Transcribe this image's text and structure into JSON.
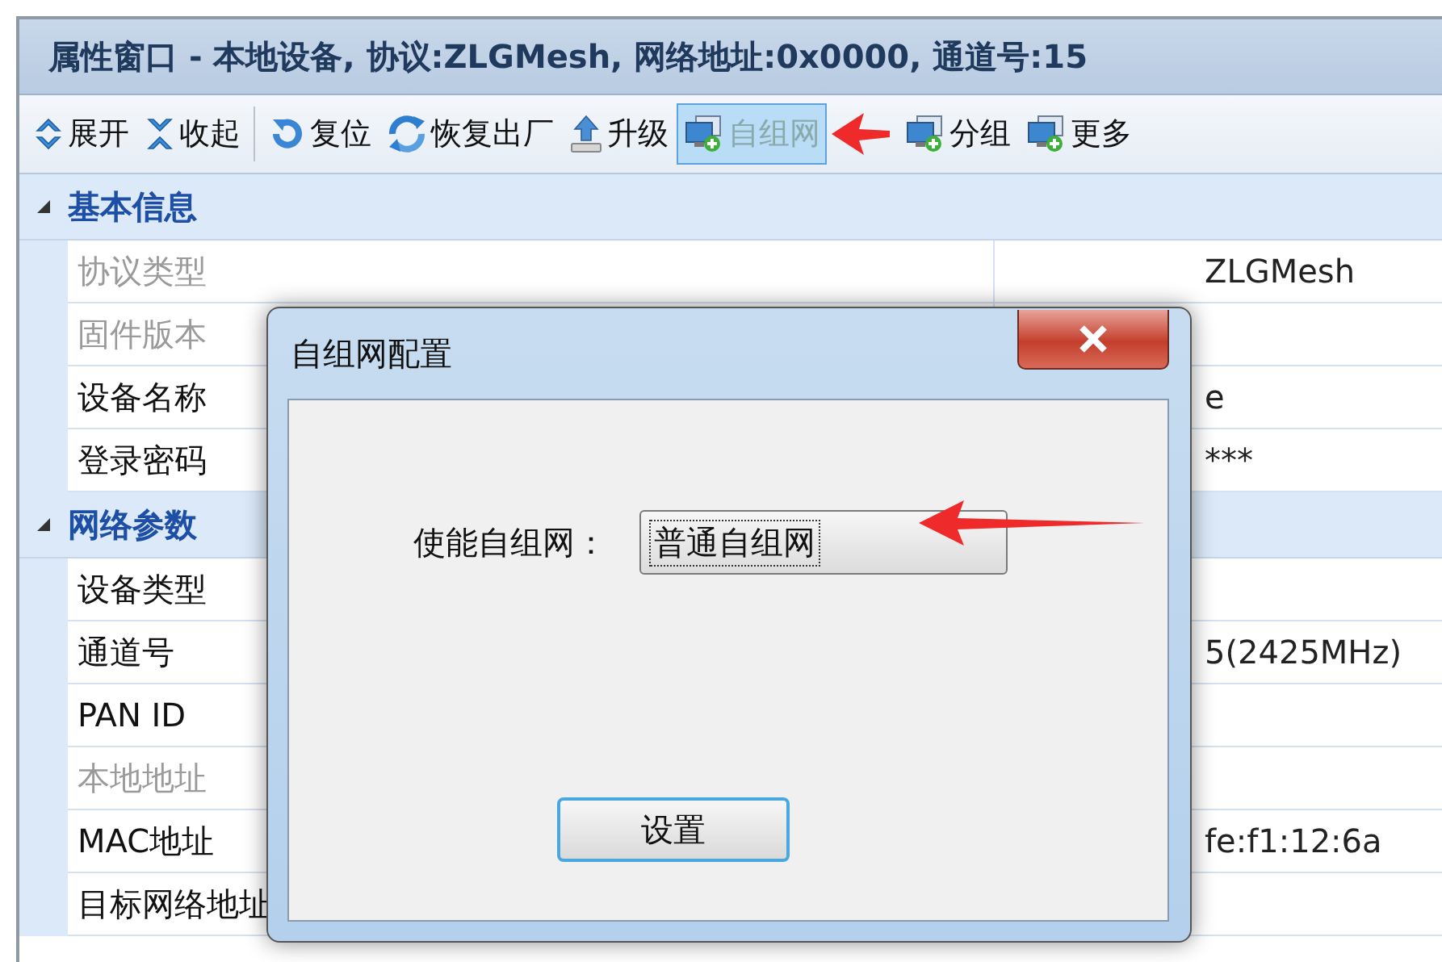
{
  "window": {
    "title": "属性窗口 - 本地设备, 协议:ZLGMesh, 网络地址:0x0000, 通道号:15"
  },
  "toolbar": {
    "groups": [
      [
        {
          "label": "展开",
          "selected": false
        },
        {
          "label": "收起",
          "selected": false
        }
      ],
      [
        {
          "label": "复位",
          "selected": false
        },
        {
          "label": "恢复出厂",
          "selected": false
        },
        {
          "label": "升级",
          "selected": false
        },
        {
          "label": "自组网",
          "selected": true
        },
        {
          "label": "分组",
          "selected": false
        },
        {
          "label": "更多",
          "selected": false
        }
      ]
    ]
  },
  "grid": {
    "categories": [
      {
        "label": "基本信息",
        "expanded": true,
        "rows": [
          {
            "name": "协议类型",
            "value": "ZLGMesh",
            "disabled": true
          },
          {
            "name": "固件版本",
            "disabled": true
          },
          {
            "name": "设备名称",
            "value": "e",
            "disabled": false
          },
          {
            "name": "登录密码",
            "value": "***",
            "disabled": false
          }
        ]
      },
      {
        "label": "网络参数",
        "expanded": true,
        "rows": [
          {
            "name": "设备类型",
            "disabled": false
          },
          {
            "name": "通道号",
            "value": "5(2425MHz)",
            "disabled": false
          },
          {
            "name": "PAN ID",
            "disabled": false
          },
          {
            "name": "本地地址",
            "disabled": true
          },
          {
            "name": "MAC地址",
            "value": "fe:f1:12:6a",
            "disabled": false
          },
          {
            "name": "目标网络地址",
            "disabled": false
          }
        ]
      }
    ]
  },
  "dialog": {
    "title": "自组网配置",
    "field_label": "使能自组网：",
    "combo_value": "普通自组网",
    "button": "设置"
  }
}
